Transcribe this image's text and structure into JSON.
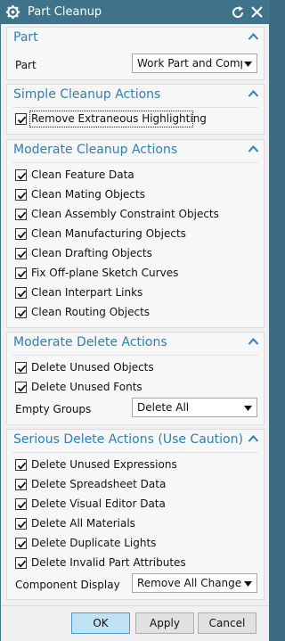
{
  "window": {
    "title": "Part Cleanup"
  },
  "part_panel": {
    "title": "Part",
    "field_label": "Part",
    "select_value": "Work Part and Compo"
  },
  "simple_panel": {
    "title": "Simple Cleanup Actions",
    "items": [
      {
        "label": "Remove Extraneous Highlighting",
        "checked": true
      }
    ]
  },
  "moderate_cleanup_panel": {
    "title": "Moderate Cleanup Actions",
    "items": [
      {
        "label": "Clean Feature Data",
        "checked": true
      },
      {
        "label": "Clean Mating Objects",
        "checked": true
      },
      {
        "label": "Clean Assembly Constraint Objects",
        "checked": true
      },
      {
        "label": "Clean Manufacturing Objects",
        "checked": true
      },
      {
        "label": "Clean Drafting Objects",
        "checked": true
      },
      {
        "label": "Fix Off-plane Sketch Curves",
        "checked": true
      },
      {
        "label": "Clean Interpart Links",
        "checked": true
      },
      {
        "label": "Clean Routing Objects",
        "checked": true
      }
    ]
  },
  "moderate_delete_panel": {
    "title": "Moderate Delete Actions",
    "items": [
      {
        "label": "Delete Unused Objects",
        "checked": true
      },
      {
        "label": "Delete Unused Fonts",
        "checked": true
      }
    ],
    "field_label": "Empty Groups",
    "select_value": "Delete All"
  },
  "serious_delete_panel": {
    "title": "Serious Delete Actions (Use Caution)",
    "items": [
      {
        "label": "Delete Unused Expressions",
        "checked": true
      },
      {
        "label": "Delete Spreadsheet Data",
        "checked": true
      },
      {
        "label": "Delete Visual Editor Data",
        "checked": true
      },
      {
        "label": "Delete All Materials",
        "checked": true
      },
      {
        "label": "Delete Duplicate Lights",
        "checked": true
      },
      {
        "label": "Delete Invalid Part Attributes",
        "checked": true
      }
    ],
    "field_label": "Component Display",
    "select_value": "Remove All Changes"
  },
  "footer": {
    "ok_label": "OK",
    "apply_label": "Apply",
    "cancel_label": "Cancel"
  },
  "icons": {
    "window_icon": "gear-icon",
    "reset": "reset-icon",
    "close": "close-icon",
    "collapse": "chevron-up-icon",
    "dropdown": "chevron-down-icon",
    "check": "checkmark-icon"
  },
  "colors": {
    "titlebar": "#3f7389",
    "section_title": "#2f7fb3",
    "primary_button": "#bfe3f5"
  }
}
